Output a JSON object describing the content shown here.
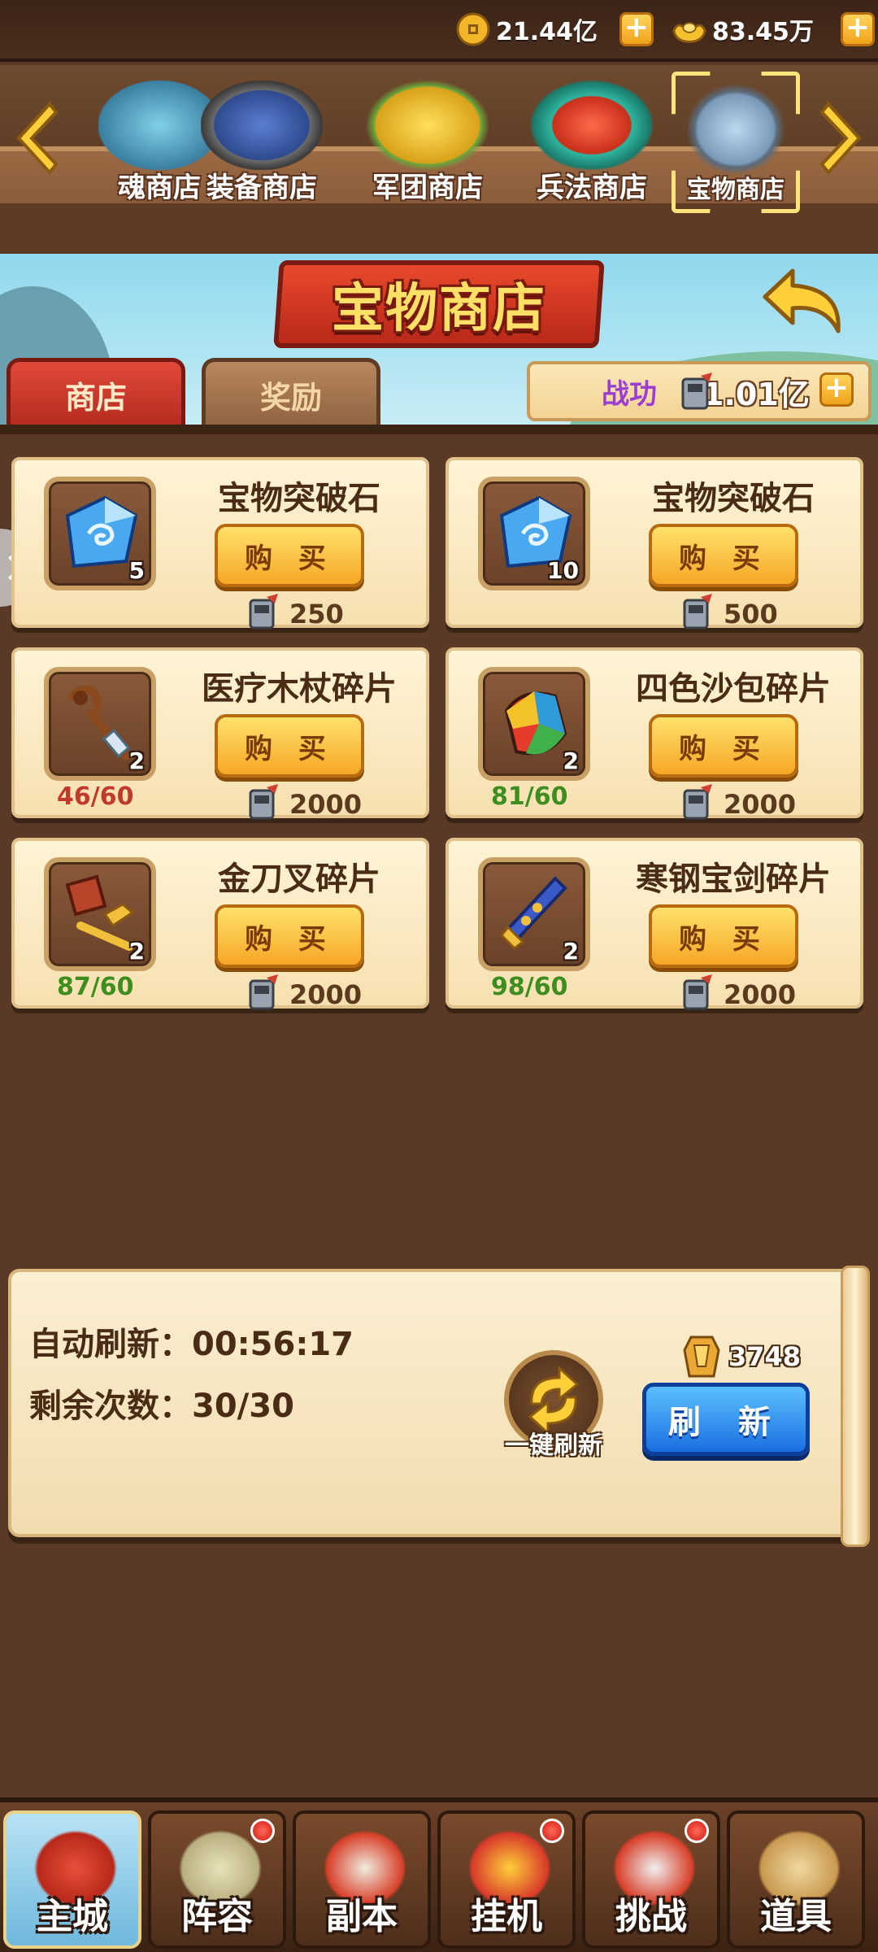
{
  "currencies": {
    "coins": "21.44亿",
    "ingots": "83.45万"
  },
  "shop_tabs": [
    {
      "label": "魂商店"
    },
    {
      "label": "装备商店"
    },
    {
      "label": "军团商店"
    },
    {
      "label": "兵法商店"
    },
    {
      "label": "宝物商店",
      "selected": true
    }
  ],
  "header": {
    "title": "宝物商店",
    "tab_shop": "商店",
    "tab_reward": "奖励",
    "power_label": "战功",
    "power_value": "1.01亿"
  },
  "items": [
    {
      "name": "宝物突破石",
      "qty": "5",
      "buy": "购 买",
      "price": "250",
      "progress": "",
      "icon": "breakthrough-stone-icon"
    },
    {
      "name": "宝物突破石",
      "qty": "10",
      "buy": "购 买",
      "price": "500",
      "progress": "",
      "icon": "breakthrough-stone-icon"
    },
    {
      "name": "医疗木杖碎片",
      "qty": "2",
      "buy": "购 买",
      "price": "2000",
      "progress": "46/60",
      "progress_color": "#c0392b",
      "icon": "staff-icon"
    },
    {
      "name": "四色沙包碎片",
      "qty": "2",
      "buy": "购 买",
      "price": "2000",
      "progress": "81/60",
      "progress_color": "#3e8e1f",
      "icon": "sandbag-icon"
    },
    {
      "name": "金刀叉碎片",
      "qty": "2",
      "buy": "购 买",
      "price": "2000",
      "progress": "87/60",
      "progress_color": "#3e8e1f",
      "icon": "knife-fork-icon"
    },
    {
      "name": "寒钢宝剑碎片",
      "qty": "2",
      "buy": "购 买",
      "price": "2000",
      "progress": "98/60",
      "progress_color": "#3e8e1f",
      "icon": "sword-icon"
    }
  ],
  "refresh": {
    "auto_refresh": "自动刷新：00:56:17",
    "remaining": "剩余次数：30/30",
    "one_click_label": "一键刷新",
    "cost": "3748",
    "button_label": "刷 新"
  },
  "bottom_nav": [
    {
      "label": "主城",
      "active": true,
      "dot": false
    },
    {
      "label": "阵容",
      "active": false,
      "dot": true
    },
    {
      "label": "副本",
      "active": false,
      "dot": false
    },
    {
      "label": "挂机",
      "active": false,
      "dot": true
    },
    {
      "label": "挑战",
      "active": false,
      "dot": true
    },
    {
      "label": "道具",
      "active": false,
      "dot": false
    }
  ],
  "colors": {
    "accent_gold": "#f6a726",
    "refresh_blue": "#1a6fe0",
    "progress_red": "#c0392b",
    "progress_green": "#3e8e1f"
  }
}
